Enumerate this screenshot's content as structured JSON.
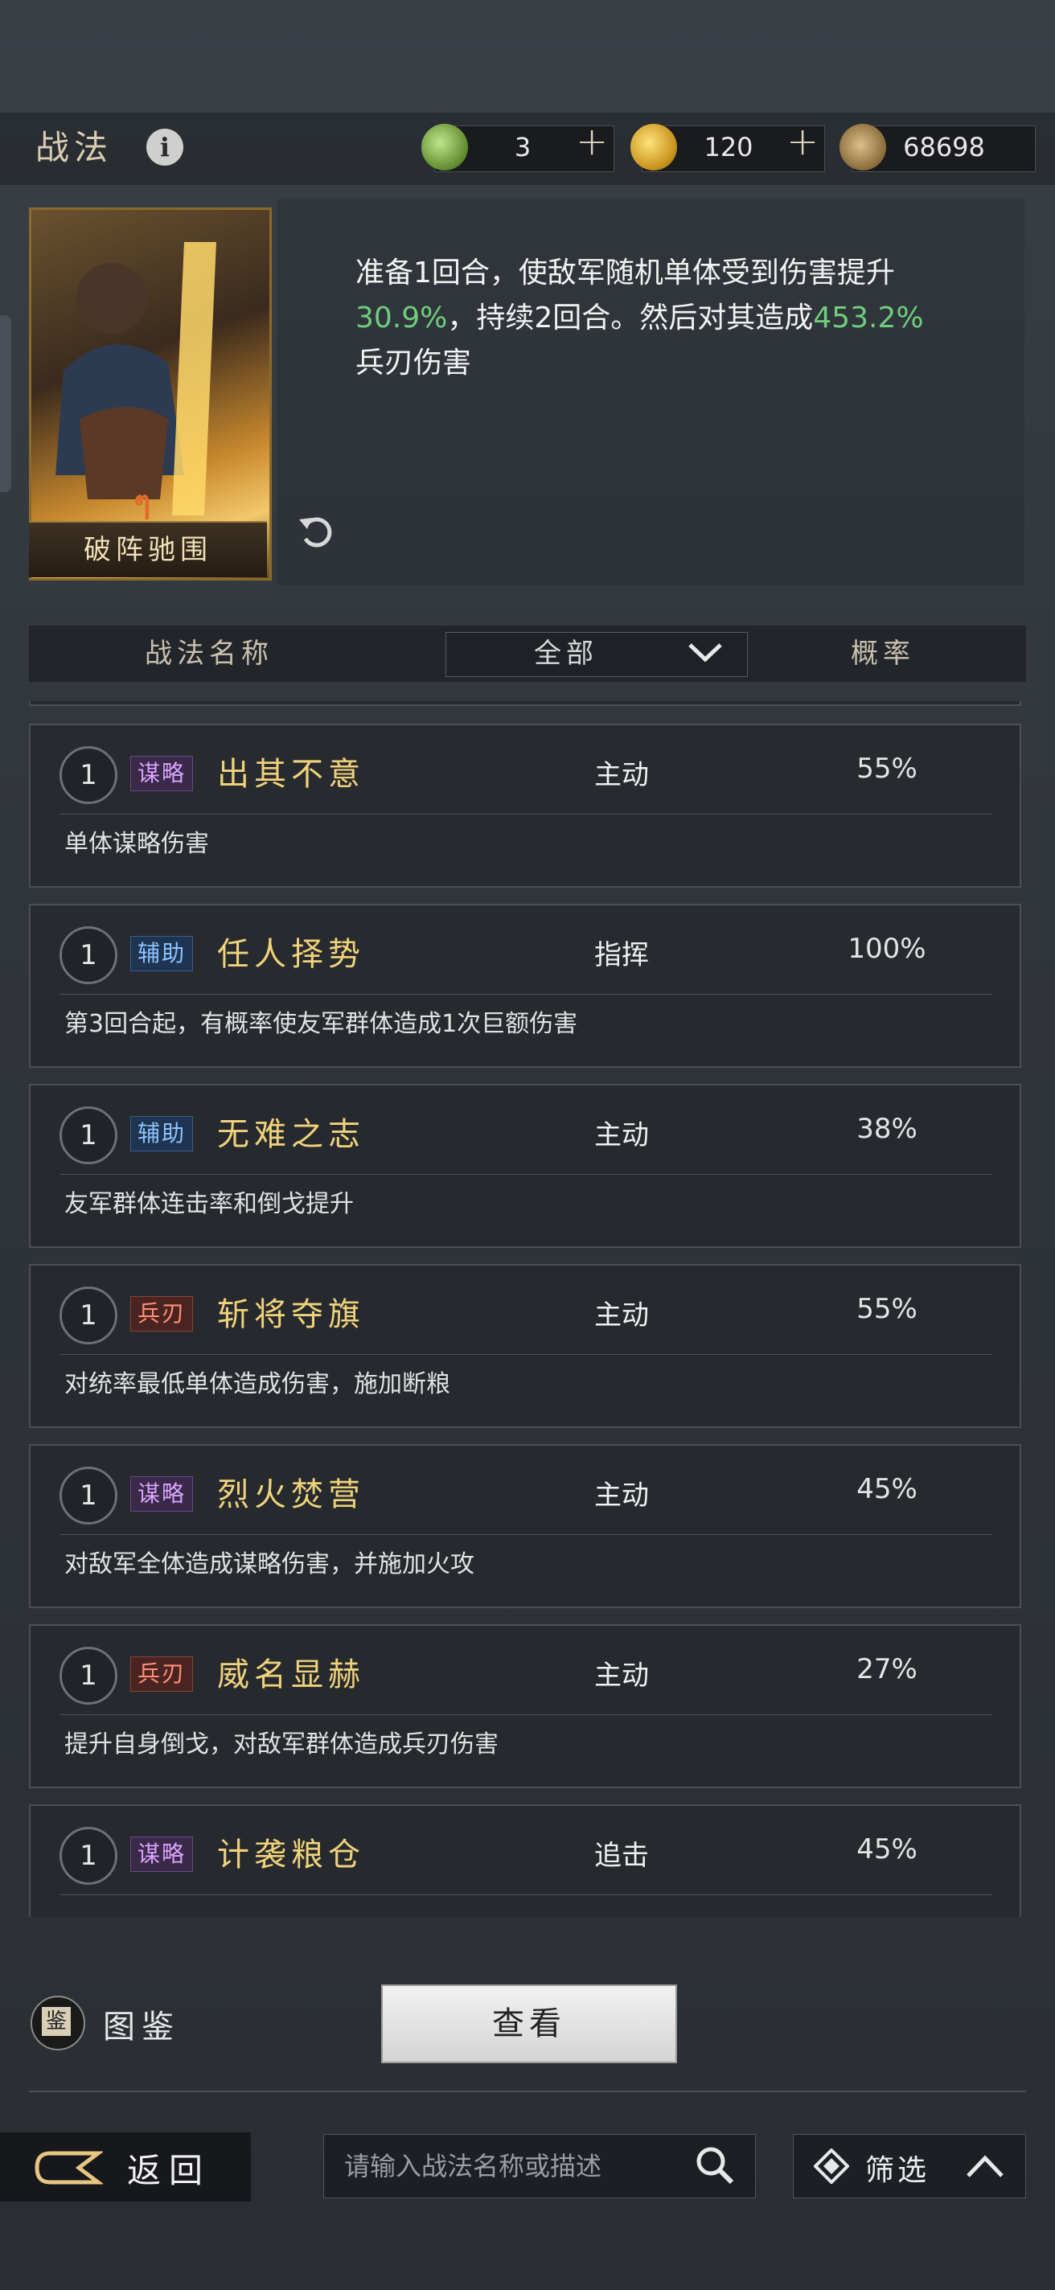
{
  "header": {
    "title": "战法",
    "info_icon": "info-icon"
  },
  "currencies": [
    {
      "icon": "jade-icon",
      "value": "3"
    },
    {
      "icon": "gold-coin-icon",
      "value": "120"
    },
    {
      "icon": "copper-coin-icon",
      "value": "68698"
    }
  ],
  "featured": {
    "card_name": "破阵驰围",
    "description_parts": [
      {
        "text": "准备1回合，使敌军随机单体受到伤害提升",
        "green": false
      },
      {
        "text": "30.9%",
        "green": true
      },
      {
        "text": "，持续2回合。然后对其造成",
        "green": false
      },
      {
        "text": "453.2%",
        "green": true
      },
      {
        "text": "兵刃伤害",
        "green": false
      }
    ]
  },
  "table": {
    "col_name": "战法名称",
    "filter_value": "全部",
    "col_rate": "概率"
  },
  "skills": [
    {
      "level": "1",
      "tag": "谋略",
      "tag_type": "mou",
      "name": "出其不意",
      "type": "主动",
      "rate": "55%",
      "desc": "单体谋略伤害"
    },
    {
      "level": "1",
      "tag": "辅助",
      "tag_type": "fu",
      "name": "任人择势",
      "type": "指挥",
      "rate": "100%",
      "desc": "第3回合起，有概率使友军群体造成1次巨额伤害"
    },
    {
      "level": "1",
      "tag": "辅助",
      "tag_type": "fu",
      "name": "无难之志",
      "type": "主动",
      "rate": "38%",
      "desc": "友军群体连击率和倒戈提升"
    },
    {
      "level": "1",
      "tag": "兵刃",
      "tag_type": "bing",
      "name": "斩将夺旗",
      "type": "主动",
      "rate": "55%",
      "desc": "对统率最低单体造成伤害，施加断粮"
    },
    {
      "level": "1",
      "tag": "谋略",
      "tag_type": "mou",
      "name": "烈火焚营",
      "type": "主动",
      "rate": "45%",
      "desc": "对敌军全体造成谋略伤害，并施加火攻"
    },
    {
      "level": "1",
      "tag": "兵刃",
      "tag_type": "bing",
      "name": "威名显赫",
      "type": "主动",
      "rate": "27%",
      "desc": "提升自身倒戈，对敌军群体造成兵刃伤害"
    },
    {
      "level": "1",
      "tag": "谋略",
      "tag_type": "mou",
      "name": "计袭粮仓",
      "type": "追击",
      "rate": "45%",
      "desc": ""
    }
  ],
  "bottom": {
    "atlas_label": "图鉴",
    "view_button": "查看",
    "back_label": "返回",
    "search_placeholder": "请输入战法名称或描述",
    "filter_label": "筛选"
  },
  "colors": {
    "green": "#6fce7c",
    "gold": "#f0d27a"
  }
}
